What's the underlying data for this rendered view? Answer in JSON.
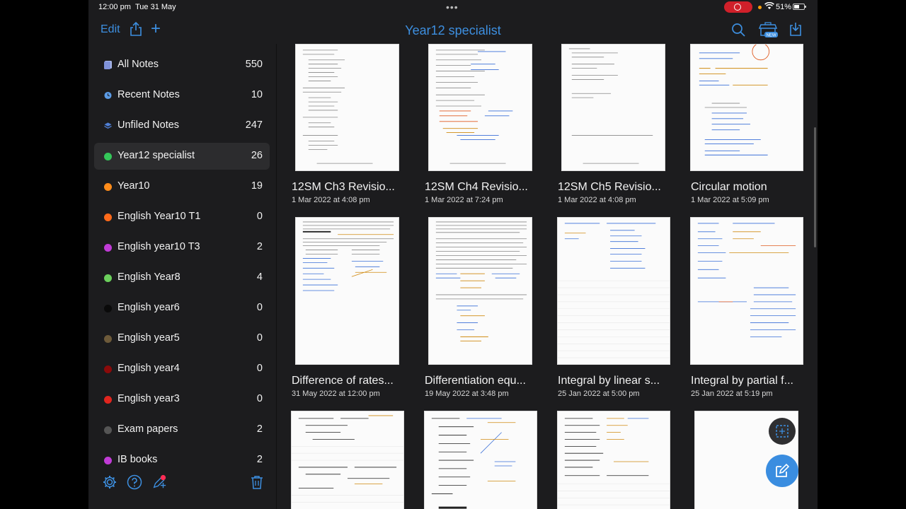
{
  "status_bar": {
    "time": "12:00 pm",
    "date": "Tue 31 May",
    "battery": "51%"
  },
  "nav": {
    "edit": "Edit",
    "title": "Year12 specialist",
    "store_badge": "NEW"
  },
  "sidebar": {
    "items": [
      {
        "label": "All Notes",
        "count": "550",
        "color": "#a9b7e8",
        "icon": "all-notes-icon"
      },
      {
        "label": "Recent Notes",
        "count": "10",
        "color": "#5b9be6",
        "icon": "clock-icon"
      },
      {
        "label": "Unfiled Notes",
        "count": "247",
        "color": "#4f7fd6",
        "icon": "stack-icon"
      },
      {
        "label": "Year12 specialist",
        "count": "26",
        "color": "#34c759",
        "icon": "dot"
      },
      {
        "label": "Year10",
        "count": "19",
        "color": "#ff8c1a",
        "icon": "dot"
      },
      {
        "label": "English Year10 T1",
        "count": "0",
        "color": "#ff6a1a",
        "icon": "dot"
      },
      {
        "label": "English year10 T3",
        "count": "2",
        "color": "#c03bd6",
        "icon": "dot"
      },
      {
        "label": "English Year8",
        "count": "4",
        "color": "#6bcf5c",
        "icon": "dot"
      },
      {
        "label": "English year6",
        "count": "0",
        "color": "#0a0a0a",
        "icon": "dot"
      },
      {
        "label": "English year5",
        "count": "0",
        "color": "#6d5a3a",
        "icon": "dot"
      },
      {
        "label": "English year4",
        "count": "0",
        "color": "#8b0a0a",
        "icon": "dot"
      },
      {
        "label": "English year3",
        "count": "0",
        "color": "#e0251e",
        "icon": "dot"
      },
      {
        "label": "Exam papers",
        "count": "2",
        "color": "#555555",
        "icon": "dot"
      },
      {
        "label": "IB books",
        "count": "2",
        "color": "#c03bd6",
        "icon": "dot"
      }
    ]
  },
  "notes": [
    {
      "title": "12SM Ch3 Revisio...",
      "date": "1 Mar 2022 at 4:08 pm"
    },
    {
      "title": "12SM Ch4 Revisio...",
      "date": "1 Mar 2022 at 7:24 pm"
    },
    {
      "title": "12SM Ch5 Revisio...",
      "date": "1 Mar 2022 at 4:08 pm"
    },
    {
      "title": "Circular motion",
      "date": "1 Mar 2022 at 5:09 pm"
    },
    {
      "title": "Difference of rates...",
      "date": "31 May 2022 at 12:00 pm"
    },
    {
      "title": "Differentiation equ...",
      "date": "19 May 2022 at 3:48 pm"
    },
    {
      "title": "Integral by linear s...",
      "date": "25 Jan 2022 at 5:00 pm"
    },
    {
      "title": "Integral by partial f...",
      "date": "25 Jan 2022 at 5:19 pm"
    }
  ],
  "colors": {
    "accent": "#3a8de0",
    "background": "#1c1c1e"
  }
}
